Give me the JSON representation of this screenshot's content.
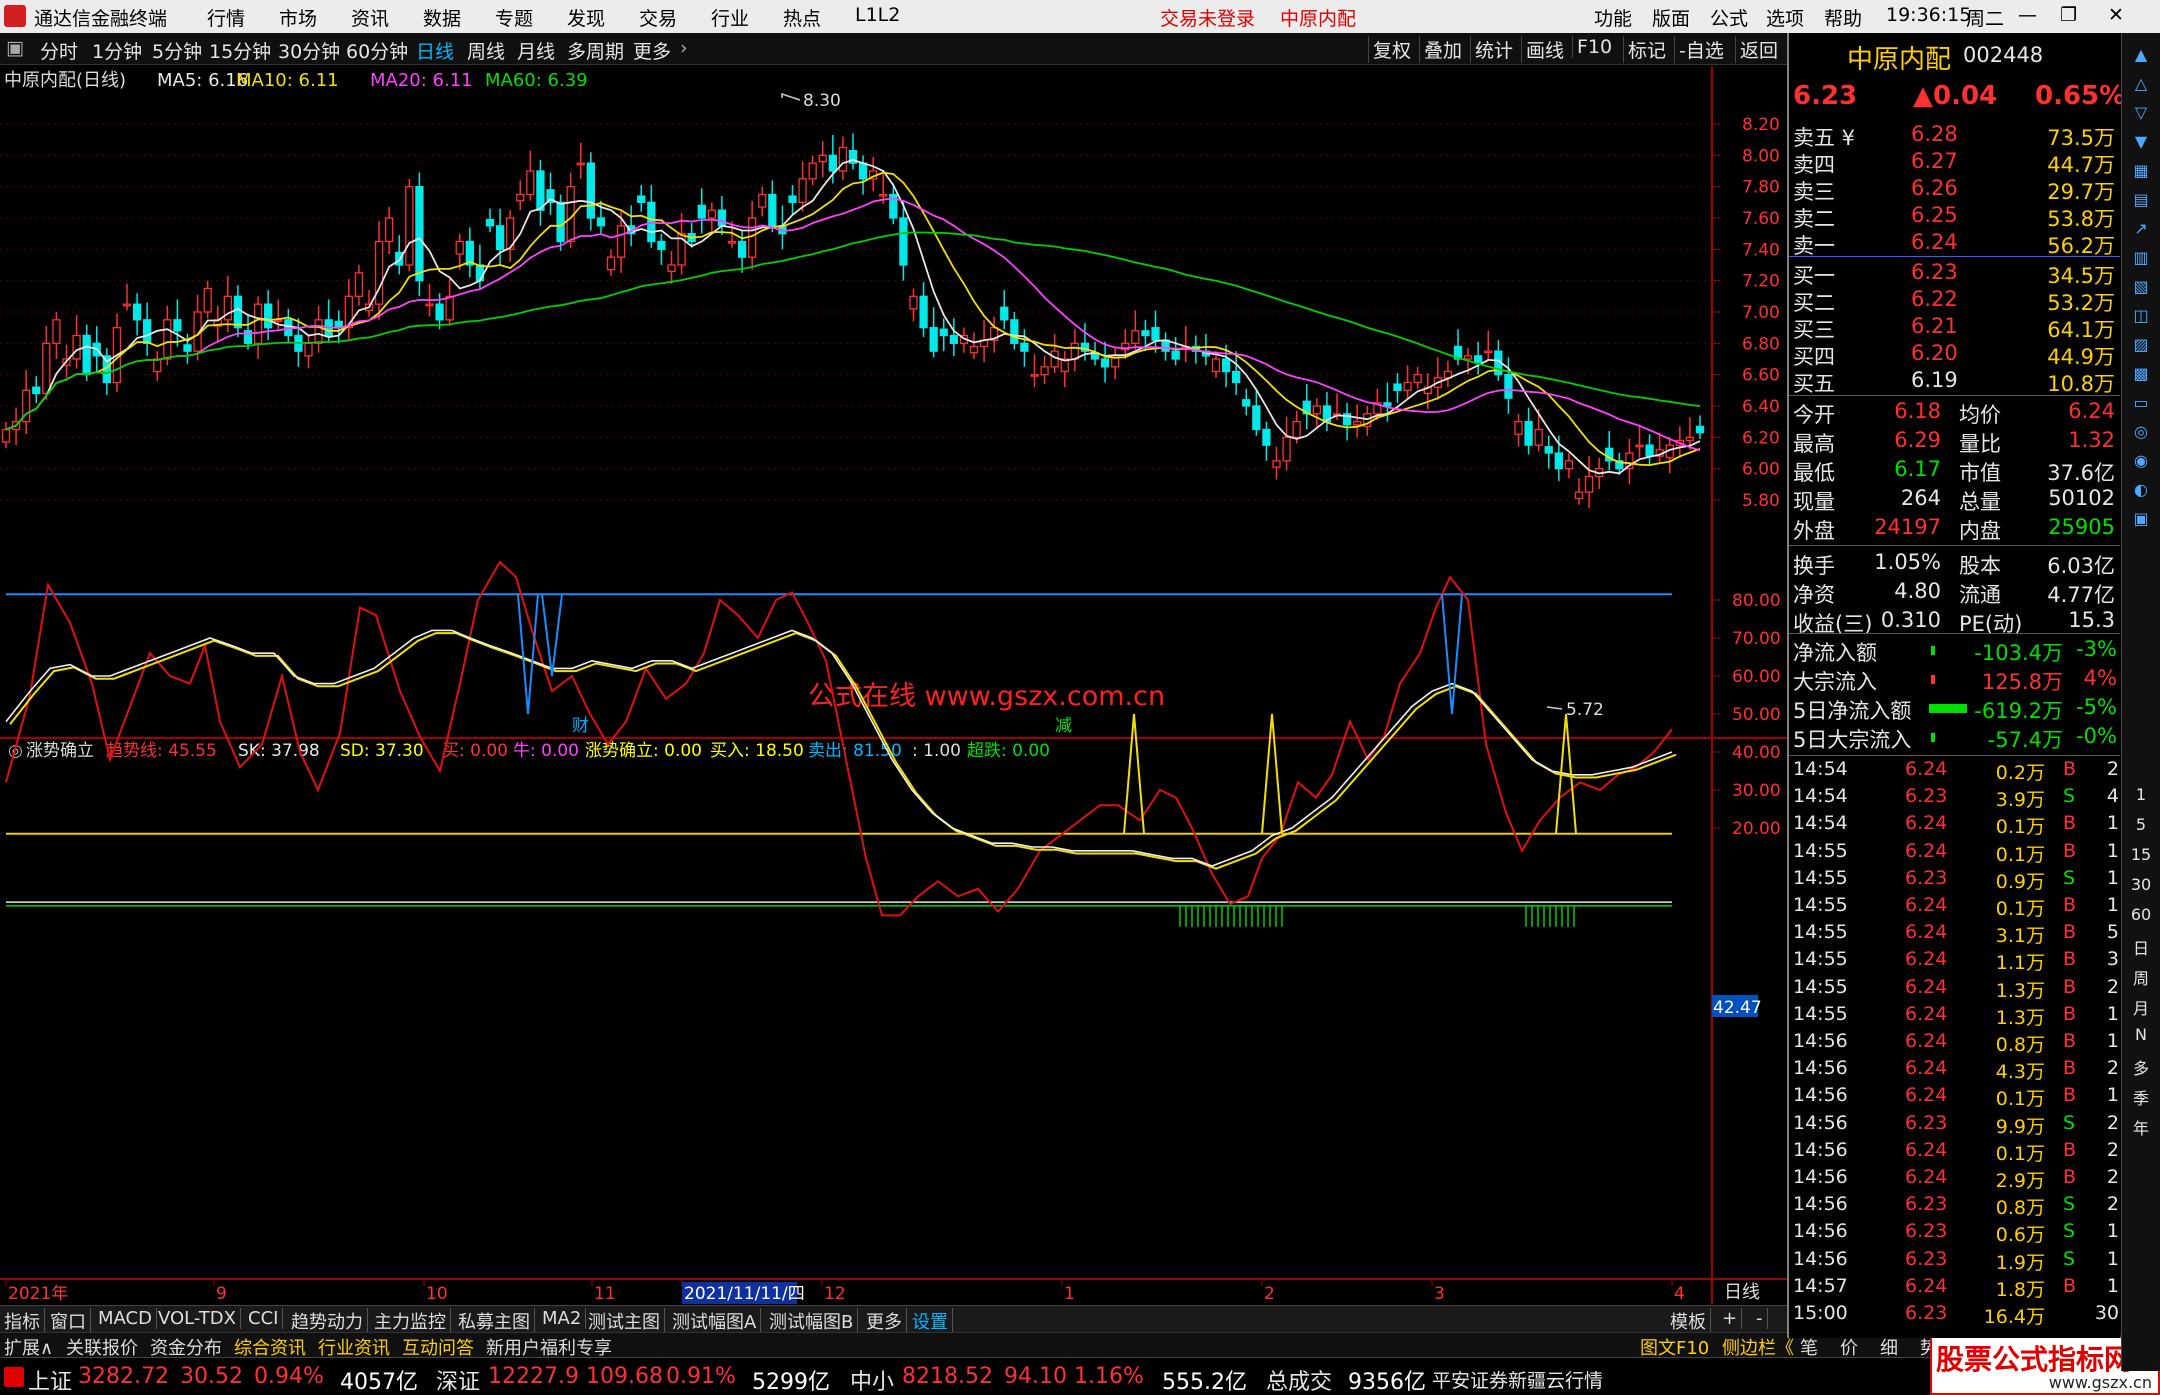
{
  "titlebar": {
    "app_title": "通达信金融终端",
    "menus": [
      "行情",
      "市场",
      "资讯",
      "数据",
      "专题",
      "发现",
      "交易",
      "行业",
      "热点",
      "L1L2"
    ],
    "trade_status": "交易未登录",
    "stock_name": "中原内配",
    "right_menus": [
      "功能",
      "版面",
      "公式",
      "选项",
      "帮助"
    ],
    "time": "19:36:15",
    "weekday": "周二"
  },
  "periods": [
    "分时",
    "1分钟",
    "5分钟",
    "15分钟",
    "30分钟",
    "60分钟",
    "日线",
    "周线",
    "月线",
    "多周期",
    "更多"
  ],
  "active_period": "日线",
  "toolbar": [
    "复权",
    "叠加",
    "统计",
    "画线",
    "F10",
    "标记",
    "-自选",
    "返回"
  ],
  "main_chart": {
    "label": "中原内配(日线)",
    "ma5": "MA5: 6.16",
    "ma10": "MA10: 6.11",
    "ma20": "MA20: 6.11",
    "ma60": "MA60: 6.39",
    "high_label": "8.30",
    "low_label": "5.72",
    "watermark": "公式在线 www.gszx.com.cn",
    "marker_cai": "财",
    "marker_jian": "减",
    "price_ticks": [
      "8.20",
      "8.00",
      "7.80",
      "7.60",
      "7.40",
      "7.20",
      "7.00",
      "6.80",
      "6.60",
      "6.40",
      "6.20",
      "6.00",
      "5.80"
    ]
  },
  "indicator": {
    "name": "涨势确立",
    "trend": "趋势线: 45.55",
    "sk": "SK: 37.98",
    "sd": "SD: 37.30",
    "buy": "买: 0.00",
    "niu": "牛: 0.00",
    "zsql": "涨势确立: 0.00",
    "mairu": "买入: 18.50",
    "maichu": "卖出: 81.50",
    "colon": ": 1.00",
    "chaodie": "超跌: 0.00",
    "cur_value": "42.47",
    "ticks": [
      "80.00",
      "70.00",
      "60.00",
      "50.00",
      "40.00",
      "30.00",
      "20.00"
    ]
  },
  "x_axis": {
    "labels": [
      "2021年",
      "9",
      "10",
      "11",
      "2021/11/11/四",
      "12",
      "1",
      "2",
      "3",
      "4"
    ],
    "period": "日线"
  },
  "bottom_tabs": [
    "指标",
    "窗口",
    "MACD",
    "VOL-TDX",
    "CCI",
    "趋势动力",
    "主力监控",
    "私募主图",
    "MA2",
    "测试主图",
    "测试幅图A",
    "测试幅图B",
    "更多",
    "设置"
  ],
  "bottom_right": [
    "模板",
    "+",
    "-"
  ],
  "bottom_bar2": [
    "扩展∧",
    "关联报价",
    "资金分布",
    "综合资讯",
    "行业资讯",
    "互动问答",
    "新用户福利专享"
  ],
  "bottom_bar2_right": [
    "图文F10",
    "侧边栏《",
    "笔",
    "价",
    "细",
    "势"
  ],
  "quote": {
    "name": "中原内配",
    "code": "002448",
    "price": "6.23",
    "change": "▲0.04",
    "pct": "0.65%",
    "asks": [
      [
        "卖五 ¥",
        "6.28",
        "73.5万"
      ],
      [
        "卖四",
        "6.27",
        "44.7万"
      ],
      [
        "卖三",
        "6.26",
        "29.7万"
      ],
      [
        "卖二",
        "6.25",
        "53.8万"
      ],
      [
        "卖一",
        "6.24",
        "56.2万"
      ]
    ],
    "bids": [
      [
        "买一",
        "6.23",
        "34.5万"
      ],
      [
        "买二",
        "6.22",
        "53.2万"
      ],
      [
        "买三",
        "6.21",
        "64.1万"
      ],
      [
        "买四",
        "6.20",
        "44.9万"
      ],
      [
        "买五",
        "6.19",
        "10.8万"
      ]
    ],
    "stats": [
      [
        "今开",
        "6.18",
        "均价",
        "6.24"
      ],
      [
        "最高",
        "6.29",
        "量比",
        "1.32"
      ],
      [
        "最低",
        "6.17",
        "市值",
        "37.6亿"
      ],
      [
        "现量",
        "264",
        "总量",
        "50102"
      ],
      [
        "外盘",
        "24197",
        "内盘",
        "25905"
      ]
    ],
    "stats2": [
      [
        "换手",
        "1.05%",
        "股本",
        "6.03亿"
      ],
      [
        "净资",
        "4.80",
        "流通",
        "4.77亿"
      ],
      [
        "收益(三)",
        "0.310",
        "PE(动)",
        "15.3"
      ]
    ],
    "flows": [
      [
        "净流入额",
        "-103.4万",
        "-3%"
      ],
      [
        "大宗流入",
        "125.8万",
        "4%"
      ],
      [
        "5日净流入额",
        "-619.2万",
        "-5%"
      ],
      [
        "5日大宗流入",
        "-57.4万",
        "-0%"
      ]
    ],
    "ticks": [
      [
        "14:54",
        "6.24",
        "0.2万",
        "B",
        "2"
      ],
      [
        "14:54",
        "6.23",
        "3.9万",
        "S",
        "4"
      ],
      [
        "14:54",
        "6.24",
        "0.1万",
        "B",
        "1"
      ],
      [
        "14:55",
        "6.24",
        "0.1万",
        "B",
        "1"
      ],
      [
        "14:55",
        "6.23",
        "0.9万",
        "S",
        "1"
      ],
      [
        "14:55",
        "6.24",
        "0.1万",
        "B",
        "1"
      ],
      [
        "14:55",
        "6.24",
        "3.1万",
        "B",
        "5"
      ],
      [
        "14:55",
        "6.24",
        "1.1万",
        "B",
        "3"
      ],
      [
        "14:55",
        "6.24",
        "1.3万",
        "B",
        "2"
      ],
      [
        "14:55",
        "6.24",
        "1.3万",
        "B",
        "1"
      ],
      [
        "14:56",
        "6.24",
        "0.8万",
        "B",
        "1"
      ],
      [
        "14:56",
        "6.24",
        "4.3万",
        "B",
        "2"
      ],
      [
        "14:56",
        "6.24",
        "0.1万",
        "B",
        "1"
      ],
      [
        "14:56",
        "6.23",
        "9.9万",
        "S",
        "2"
      ],
      [
        "14:56",
        "6.24",
        "0.1万",
        "B",
        "2"
      ],
      [
        "14:56",
        "6.24",
        "2.9万",
        "B",
        "2"
      ],
      [
        "14:56",
        "6.23",
        "0.8万",
        "S",
        "2"
      ],
      [
        "14:56",
        "6.23",
        "0.6万",
        "S",
        "1"
      ],
      [
        "14:56",
        "6.23",
        "1.9万",
        "S",
        "1"
      ],
      [
        "14:57",
        "6.24",
        "1.8万",
        "B",
        "1"
      ],
      [
        "15:00",
        "6.23",
        "16.4万",
        "",
        "30"
      ]
    ]
  },
  "sidebar_labels": [
    "1",
    "5",
    "15",
    "30",
    "60",
    "日",
    "周",
    "月",
    "N",
    "多",
    "季",
    "年"
  ],
  "status": {
    "sh": "上证",
    "sh_val": "3282.72",
    "sh_chg": "30.52",
    "sh_pct": "0.94%",
    "sh_amt": "4057亿",
    "sz": "深证",
    "sz_val": "12227.9",
    "sz_chg": "109.68",
    "sz_pct": "0.91%",
    "sz_amt": "5299亿",
    "zx": "中小",
    "zx_val": "8218.52",
    "zx_chg": "94.10",
    "zx_pct": "1.16%",
    "zx_amt": "555.2亿",
    "total": "总成交",
    "total_val": "9356亿",
    "broker": "平安证券新疆云行情",
    "brand": "股票公式指标网",
    "brand_url": "www.gszx.cn"
  }
}
